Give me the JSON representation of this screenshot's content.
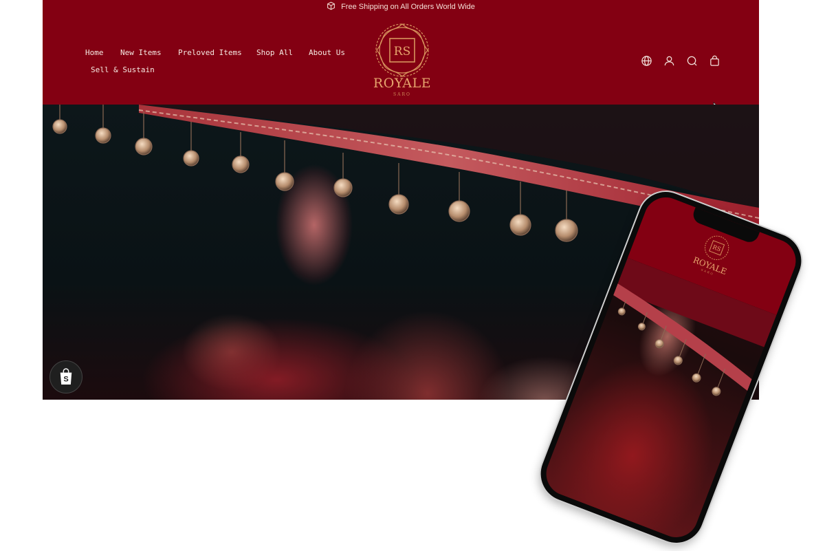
{
  "announcement": {
    "text": "Free Shipping on All Orders World Wide",
    "icon": "box-icon"
  },
  "nav": {
    "items": [
      {
        "label": "Home"
      },
      {
        "label": "New Items"
      },
      {
        "label": "Preloved Items"
      },
      {
        "label": "Shop All"
      },
      {
        "label": "About Us"
      },
      {
        "label": "Sell & Sustain"
      }
    ]
  },
  "logo": {
    "monogram": "RS",
    "brand": "ROYALE",
    "sub": "SARO"
  },
  "header_icons": [
    "globe-icon",
    "account-icon",
    "search-icon",
    "cart-icon"
  ],
  "mobile": {
    "monogram": "RS",
    "brand": "ROYALE",
    "sub": "SARO"
  },
  "colors": {
    "header_bg": "#830012",
    "gold": "#e6a56d",
    "nav_text": "#f6e9e3"
  }
}
